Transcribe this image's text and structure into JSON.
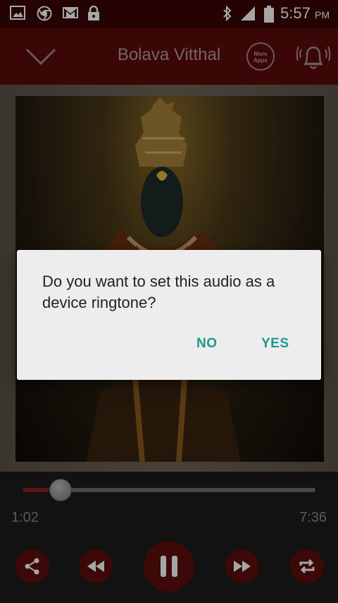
{
  "status_bar": {
    "icons": [
      "gallery-icon",
      "chrome-icon",
      "gmail-icon",
      "lock-icon",
      "bluetooth-icon",
      "signal-icon",
      "battery-icon"
    ],
    "time": "5:57",
    "ampm": "PM"
  },
  "app_bar": {
    "title": "Bolava Vitthal",
    "more_apps_label": "More Apps"
  },
  "player": {
    "current_time": "1:02",
    "total_time": "7:36",
    "progress": 0.13
  },
  "dialog": {
    "message": "Do you want to set this audio as a device ringtone?",
    "no_label": "NO",
    "yes_label": "YES"
  },
  "colors": {
    "app_bar": "#5a0a0a",
    "accent": "#1a9a8e",
    "control_bg": "#5c0d0d"
  }
}
